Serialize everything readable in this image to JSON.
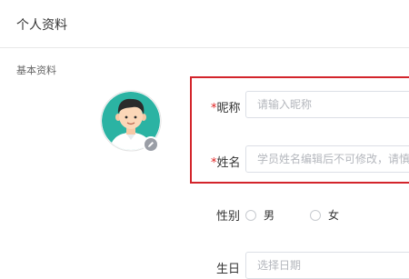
{
  "header": {
    "title": "个人资料"
  },
  "section": {
    "title": "基本资料"
  },
  "form": {
    "nickname": {
      "required_mark": "*",
      "label": "昵称",
      "placeholder": "请输入昵称",
      "value": ""
    },
    "realname": {
      "required_mark": "*",
      "label": "姓名",
      "placeholder": "学员姓名编辑后不可修改，请慎重填写",
      "value": ""
    },
    "gender": {
      "label": "性别",
      "options": [
        "男",
        "女"
      ],
      "selected": null
    },
    "birthday": {
      "label": "生日",
      "placeholder": "选择日期",
      "value": ""
    }
  },
  "colors": {
    "highlight": "#d3242b",
    "required": "#e02020",
    "avatar_bg": "#2bb3a3"
  },
  "icons": {
    "avatar": "avatar-illustration",
    "edit": "pencil-icon"
  }
}
